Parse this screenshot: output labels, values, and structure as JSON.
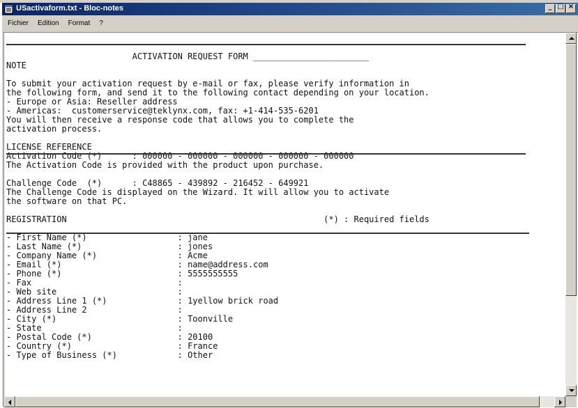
{
  "window": {
    "title": "USactivaform.txt - Bloc-notes"
  },
  "titlebar_buttons": {
    "minimize": "_",
    "maximize": "□",
    "close": "×"
  },
  "menu": [
    "Fichier",
    "Edition",
    "Format",
    "?"
  ],
  "document": {
    "lines": [
      "",
      "",
      "                         ACTIVATION REQUEST FORM _______________________",
      "NOTE",
      "",
      "To submit your activation request by e-mail or fax, please verify information in",
      "the following form, and send it to the following contact depending on your location.",
      "- Europe or Asia: Reseller address",
      "- Americas:  customerservice@teklynx.com, fax: +1-414-535-6201",
      "You will then receive a response code that allows you to complete the",
      "activation process.",
      "",
      "LICENSE REFERENCE",
      "Activation Code (*)      : 000000 - 000000 - 000000 - 000000 - 000000",
      "The Activation Code is provided with the product upon purchase.",
      "",
      "Challenge Code  (*)      : C48865 - 439892 - 216452 - 649921",
      "The Challenge Code is displayed on the Wizard. It will allow you to activate",
      "the software on that PC.",
      "",
      "REGISTRATION                                                   (*) : Required fields",
      "",
      "- First Name (*)                  : jane",
      "- Last Name (*)                   : jones",
      "- Company Name (*)                : Acme",
      "- Email (*)                       : name@address.com",
      "- Phone (*)                       : 5555555555",
      "- Fax                             :",
      "- Web site                        :",
      "- Address Line 1 (*)              : 1yellow brick road",
      "- Address Line 2                  :",
      "- City (*)                        : Toonville",
      "- State                           :",
      "- Postal Code (*)                 : 20100",
      "- Country (*)                     : France",
      "- Type of Business (*)            : Other",
      ""
    ]
  }
}
